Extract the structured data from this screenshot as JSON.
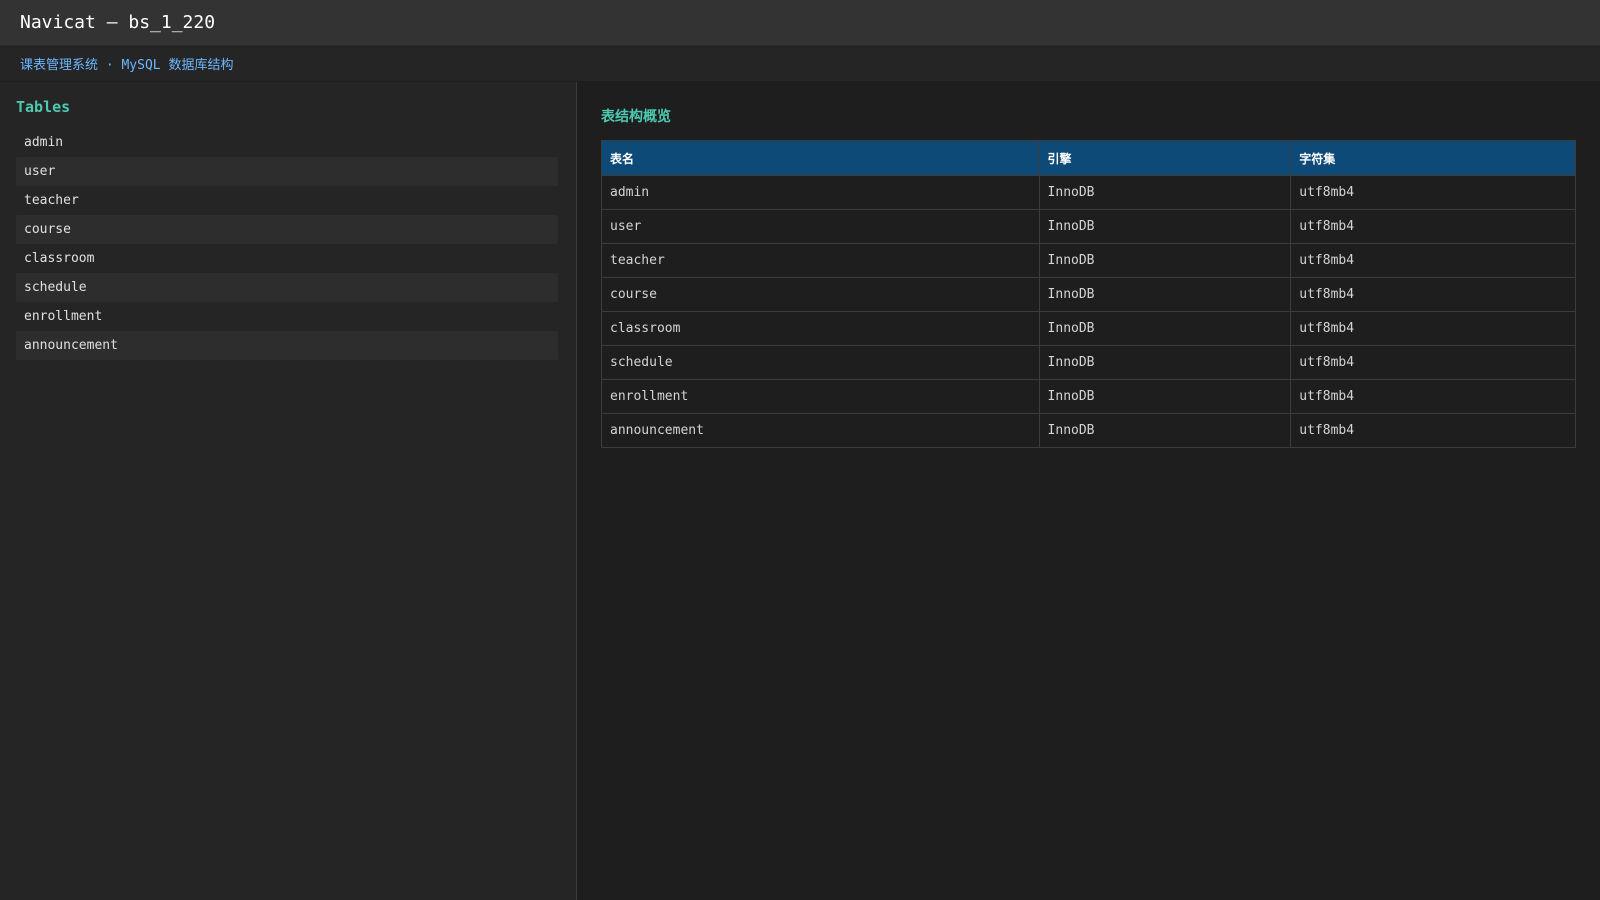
{
  "window": {
    "title": "Navicat — bs_1_220"
  },
  "breadcrumb": {
    "text": "课表管理系统 · MySQL 数据库结构"
  },
  "sidebar": {
    "title": "Tables",
    "items": [
      {
        "label": "admin"
      },
      {
        "label": "user"
      },
      {
        "label": "teacher"
      },
      {
        "label": "course"
      },
      {
        "label": "classroom"
      },
      {
        "label": "schedule"
      },
      {
        "label": "enrollment"
      },
      {
        "label": "announcement"
      }
    ]
  },
  "overview": {
    "title": "表结构概览",
    "columns": [
      "表名",
      "引擎",
      "字符集"
    ],
    "rows": [
      [
        "admin",
        "InnoDB",
        "utf8mb4"
      ],
      [
        "user",
        "InnoDB",
        "utf8mb4"
      ],
      [
        "teacher",
        "InnoDB",
        "utf8mb4"
      ],
      [
        "course",
        "InnoDB",
        "utf8mb4"
      ],
      [
        "classroom",
        "InnoDB",
        "utf8mb4"
      ],
      [
        "schedule",
        "InnoDB",
        "utf8mb4"
      ],
      [
        "enrollment",
        "InnoDB",
        "utf8mb4"
      ],
      [
        "announcement",
        "InnoDB",
        "utf8mb4"
      ]
    ]
  },
  "colors": {
    "accent": "#4ec9b0",
    "link": "#6cb6ff",
    "header_bg": "#0e4a78"
  }
}
